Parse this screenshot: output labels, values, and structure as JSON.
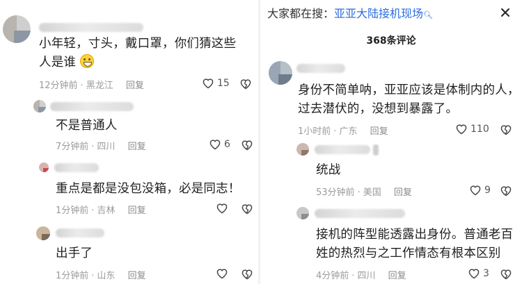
{
  "left": {
    "comments": [
      {
        "text": "小年轻，寸头，戴口罩，你们猜这些人是谁",
        "time": "12分钟前",
        "location": "黑龙江",
        "reply": "回复",
        "likes": "15"
      },
      {
        "text": "不是普通人",
        "time": "7分钟前",
        "location": "四川",
        "reply": "回复",
        "likes": "6"
      },
      {
        "text": "重点是都是没包没箱，必是同志！",
        "time": "1分钟前",
        "location": "吉林",
        "reply": "回复",
        "likes": ""
      },
      {
        "text": "出手了",
        "time": "1分钟前",
        "location": "山东",
        "reply": "回复",
        "likes": ""
      }
    ]
  },
  "right": {
    "search": {
      "prefix": "大家都在搜：",
      "query": "亚亚大陆接机现场",
      "icon": "search-icon"
    },
    "comment_count": "368条评论",
    "comments": [
      {
        "line1": "身份不简单呐，亚亚应该是体制内的人，",
        "line2": "过去潜伏的，没想到暴露了。",
        "time": "1小时前",
        "location": "广东",
        "reply": "回复",
        "likes": "110"
      },
      {
        "text": "统战",
        "time": "53分钟前",
        "location": "美国",
        "reply": "回复",
        "likes": "9"
      },
      {
        "line1": "接机的阵型能透露出身份。普通老百",
        "line2": "姓的热烈与之工作情态有根本区别",
        "time": "4分钟前",
        "location": "四川",
        "reply": "回复",
        "likes": "3"
      }
    ]
  },
  "icons": [
    "heart-icon",
    "dislike-heart-icon",
    "close-icon",
    "search-icon",
    "grin-emoji-icon"
  ]
}
